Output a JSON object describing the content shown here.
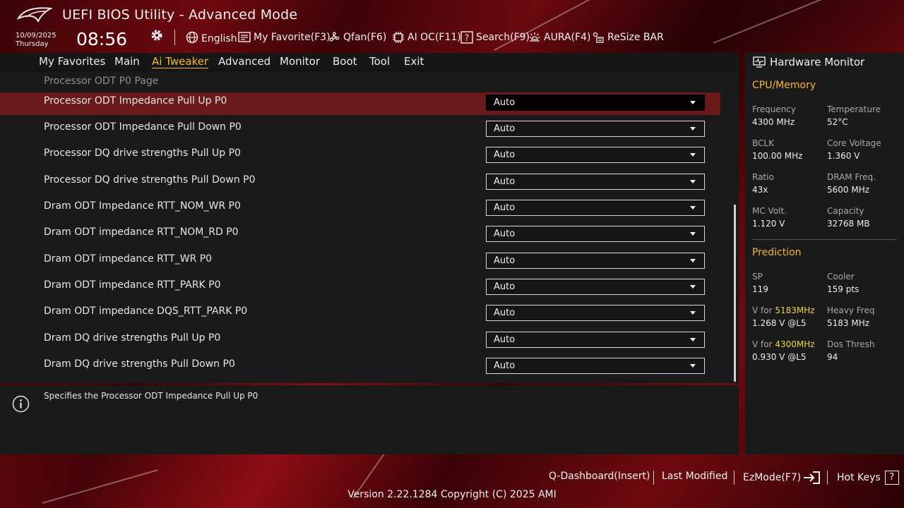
{
  "header": {
    "title": "UEFI BIOS Utility - Advanced Mode",
    "date": "10/09/2025",
    "day": "Thursday",
    "time": "08:56",
    "toolbar": {
      "language": "English",
      "my_favorite": "My Favorite(F3)",
      "qfan": "Qfan(F6)",
      "ai_oc": "AI OC(F11)",
      "search": "Search(F9)",
      "aura": "AURA(F4)",
      "resize_bar": "ReSize BAR"
    }
  },
  "menu": {
    "items": [
      "My Favorites",
      "Main",
      "Ai Tweaker",
      "Advanced",
      "Monitor",
      "Boot",
      "Tool",
      "Exit"
    ],
    "active": "Ai Tweaker"
  },
  "main": {
    "page_title": "Processor ODT P0 Page",
    "rows": [
      {
        "label": "Processor ODT Impedance Pull Up P0",
        "value": "Auto"
      },
      {
        "label": "Processor ODT Impedance Pull Down P0",
        "value": "Auto"
      },
      {
        "label": "Processor DQ drive strengths Pull Up P0",
        "value": "Auto"
      },
      {
        "label": "Processor DQ drive strengths Pull Down P0",
        "value": "Auto"
      },
      {
        "label": "Dram ODT Impedance RTT_NOM_WR P0",
        "value": "Auto"
      },
      {
        "label": "Dram ODT impedance RTT_NOM_RD P0",
        "value": "Auto"
      },
      {
        "label": "Dram ODT impedance RTT_WR P0",
        "value": "Auto"
      },
      {
        "label": "Dram ODT impedance RTT_PARK P0",
        "value": "Auto"
      },
      {
        "label": "Dram ODT impedance DQS_RTT_PARK P0",
        "value": "Auto"
      },
      {
        "label": "Dram DQ drive strengths Pull Up P0",
        "value": "Auto"
      },
      {
        "label": "Dram DQ drive strengths Pull Down P0",
        "value": "Auto"
      }
    ]
  },
  "help": {
    "text": "Specifies the Processor ODT Impedance Pull Up P0"
  },
  "hardware_monitor": {
    "title": "Hardware Monitor",
    "cpu_memory": {
      "heading": "CPU/Memory",
      "frequency_label": "Frequency",
      "frequency": "4300 MHz",
      "temperature_label": "Temperature",
      "temperature": "52°C",
      "bclk_label": "BCLK",
      "bclk": "100.00 MHz",
      "core_voltage_label": "Core Voltage",
      "core_voltage": "1.360 V",
      "ratio_label": "Ratio",
      "ratio": "43x",
      "dram_freq_label": "DRAM Freq.",
      "dram_freq": "5600 MHz",
      "mc_volt_label": "MC Volt.",
      "mc_volt": "1.120 V",
      "capacity_label": "Capacity",
      "capacity": "32768 MB"
    },
    "prediction": {
      "heading": "Prediction",
      "sp_label": "SP",
      "sp": "119",
      "cooler_label": "Cooler",
      "cooler": "159 pts",
      "v_for_prefix": "V for",
      "v_for_1_freq": "5183MHz",
      "v_for_1": "1.268 V @L5",
      "heavy_freq_label": "Heavy Freq",
      "heavy_freq": "5183 MHz",
      "v_for_2_freq": "4300MHz",
      "v_for_2": "0.930 V @L5",
      "dos_thresh_label": "Dos Thresh",
      "dos_thresh": "94"
    }
  },
  "footer": {
    "q_dashboard": "Q-Dashboard(Insert)",
    "last_modified": "Last Modified",
    "ezmode": "EzMode(F7)",
    "hot_keys": "Hot Keys",
    "hot_keys_glyph": "?",
    "version": "Version 2.22.1284 Copyright (C) 2025 AMI"
  },
  "colors": {
    "accent": "#f5b83a",
    "selected_row": "#6b1a1c",
    "brand_red": "#8d0d14",
    "highlight_value": "#f2d24a"
  },
  "icons": [
    "rog-logo",
    "gear-icon",
    "globe-icon",
    "favorite-icon",
    "fan-icon",
    "ai-chip-icon",
    "search-icon",
    "aura-icon",
    "resize-bar-icon",
    "hardware-monitor-icon",
    "info-icon",
    "ezmode-exit-icon",
    "hotkeys-icon"
  ]
}
